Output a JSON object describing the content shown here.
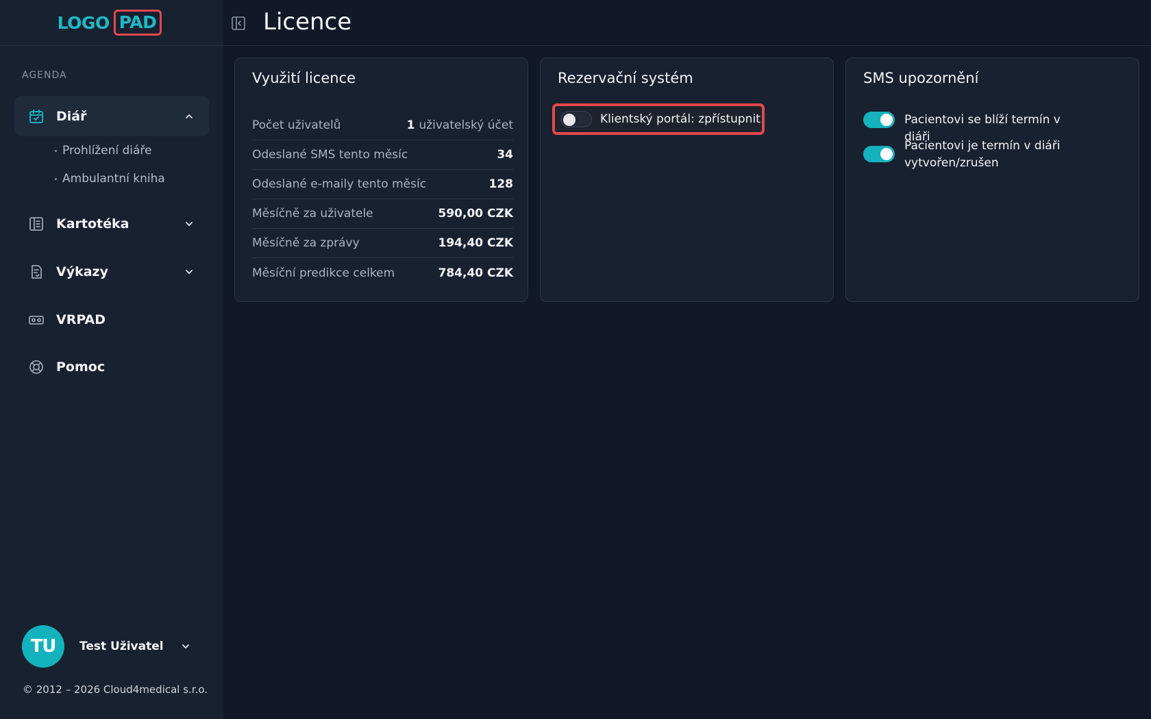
{
  "app": {
    "logo_left": "LOGO",
    "logo_right": "PAD",
    "brand_color": "#14b2bd",
    "highlight_color": "#e5484d"
  },
  "sidebar": {
    "section_label": "AGENDA",
    "items": [
      {
        "label": "Diář",
        "icon": "calendar-check-icon",
        "expanded": true,
        "children": [
          "Prohlížení diáře",
          "Ambulantní kniha"
        ]
      },
      {
        "label": "Kartotéka",
        "icon": "book-icon",
        "expanded": false
      },
      {
        "label": "Výkazy",
        "icon": "report-icon",
        "expanded": false
      },
      {
        "label": "VRPAD",
        "icon": "vr-headset-icon"
      },
      {
        "label": "Pomoc",
        "icon": "lifebuoy-icon"
      }
    ],
    "user": {
      "initials": "TU",
      "name": "Test Uživatel"
    },
    "copyright": "© 2012 – 2026 Cloud4medical s.r.o."
  },
  "header": {
    "title": "Licence"
  },
  "license_card": {
    "title": "Využití licence",
    "rows": [
      {
        "label": "Počet uživatelů",
        "value_bold": "1",
        "value_light": "uživatelský účet"
      },
      {
        "label": "Odeslané SMS tento měsíc",
        "value_bold": "34",
        "value_light": ""
      },
      {
        "label": "Odeslané e-maily tento měsíc",
        "value_bold": "128",
        "value_light": ""
      },
      {
        "label": "Měsíčně za uživatele",
        "value_bold": "590,00 CZK",
        "value_light": ""
      },
      {
        "label": "Měsíčně za zprávy",
        "value_bold": "194,40 CZK",
        "value_light": ""
      },
      {
        "label": "Měsíční predikce celkem",
        "value_bold": "784,40 CZK",
        "value_light": ""
      }
    ]
  },
  "booking_card": {
    "title": "Rezervační systém",
    "portal_toggle": {
      "label": "Klientský portál: zpřístupnit",
      "on": false
    }
  },
  "sms_card": {
    "title": "SMS upozornění",
    "toggles": [
      {
        "label": "Pacientovi se blíží termín v diáři",
        "on": true
      },
      {
        "label": "Pacientovi je termín v diáři vytvořen/zrušen",
        "on": true
      }
    ]
  }
}
